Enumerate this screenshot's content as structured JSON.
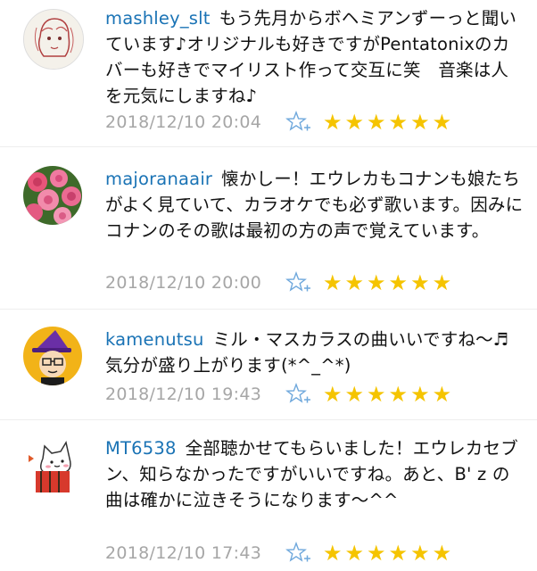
{
  "comments": [
    {
      "username": "mashley_slt",
      "text": "もう先月からボヘミアンずーっと聞いています♪オリジナルも好きですがPentatonixのカバーも好きでマイリスト作って交互に笑　音楽は人を元気にしますね♪",
      "timestamp": "2018/12/10 20:04",
      "rating": 6,
      "avatar_icon": "sketch-portrait-avatar"
    },
    {
      "username": "majoranaair",
      "text": "懐かしー！エウレカもコナンも娘たちがよく見ていて、カラオケでも必ず歌います。因みにコナンのその歌は最初の方の声で覚えています。",
      "timestamp": "2018/12/10 20:00",
      "rating": 6,
      "avatar_icon": "pink-roses-avatar"
    },
    {
      "username": "kamenutsu",
      "text": "ミル・マスカラスの曲いいですね〜♬ 気分が盛り上がります(*^_^*)",
      "timestamp": "2018/12/10 19:43",
      "rating": 6,
      "avatar_icon": "witch-hat-cartoon-avatar"
    },
    {
      "username": "MT6538",
      "text": "全部聴かせてもらいました！エウレカセブン、知らなかったですがいいですね。あと、B' z の曲は確かに泣きそうになります〜^^",
      "timestamp": "2018/12/10 17:43",
      "rating": 6,
      "avatar_icon": "cat-in-box-avatar"
    }
  ],
  "colors": {
    "username": "#1a73b5",
    "timestamp": "#a6a6a6",
    "star": "#f5c400",
    "add_star": "#6fa8dc"
  }
}
